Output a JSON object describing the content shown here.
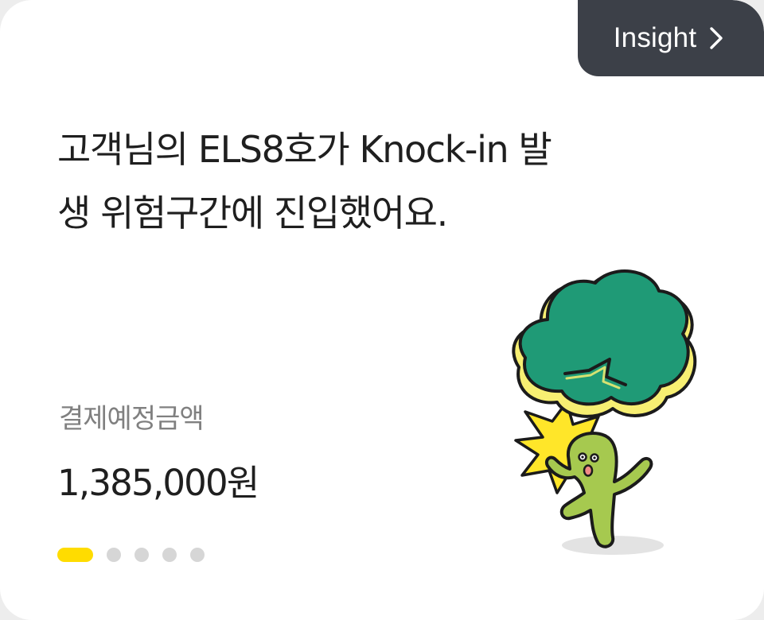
{
  "insight_button": {
    "label": "Insight",
    "icon": "chevron-right-icon"
  },
  "headline": {
    "line1": "고객님의 ELS8호가 Knock-in 발",
    "line2": "생 위험구간에 진입했어요."
  },
  "payment": {
    "label": "결제예정금액",
    "amount": "1,385,000원"
  },
  "pagination": {
    "total": 5,
    "active_index": 0
  },
  "illustration": {
    "icon": "character-hit-by-tree-illustration"
  },
  "colors": {
    "card_background": "#ffffff",
    "page_background": "#ededed",
    "insight_button_background": "#3c4048",
    "insight_button_text": "#ffffff",
    "headline_text": "#1f1f1f",
    "label_text": "#808080",
    "active_dot": "#ffdc00",
    "inactive_dot": "#d6d6d6",
    "tree_green": "#1f9a76",
    "tree_highlight": "#f7ef72",
    "character_green": "#a6c94f",
    "impact_yellow": "#ffe629"
  }
}
